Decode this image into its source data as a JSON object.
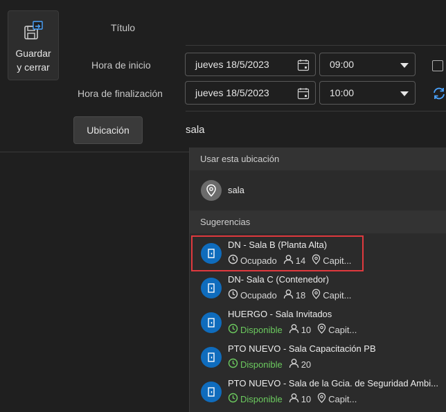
{
  "toolbar": {
    "save_close_label_1": "Guardar",
    "save_close_label_2": "y cerrar"
  },
  "form": {
    "title_label": "Título",
    "start_label": "Hora de inicio",
    "end_label": "Hora de finalización",
    "start_date": "jueves 18/5/2023",
    "start_time": "09:00",
    "end_date": "jueves 18/5/2023",
    "end_time": "10:00",
    "location_button": "Ubicación",
    "location_value": "sala"
  },
  "dropdown": {
    "use_location_header": "Usar esta ubicación",
    "use_location_value": "sala",
    "suggestions_header": "Sugerencias",
    "suggestions": [
      {
        "name": "DN - Sala B (Planta Alta)",
        "status": "Ocupado",
        "capacity": "14",
        "place": "Capit..."
      },
      {
        "name": "DN- Sala C (Contenedor)",
        "status": "Ocupado",
        "capacity": "18",
        "place": "Capit..."
      },
      {
        "name": "HUERGO - Sala Invitados",
        "status": "Disponible",
        "capacity": "10",
        "place": "Capit..."
      },
      {
        "name": "PTO NUEVO - Sala Capacitación PB",
        "status": "Disponible",
        "capacity": "20",
        "place": ""
      },
      {
        "name": "PTO NUEVO - Sala de la Gcia. de Seguridad Ambi...",
        "status": "Disponible",
        "capacity": "10",
        "place": "Capit..."
      }
    ]
  },
  "icons": {
    "save": "save-close-icon",
    "calendar": "calendar-icon",
    "dropdown": "chevron-down-icon",
    "sync": "sync-icon",
    "location": "location-pin-icon",
    "room": "room-door-icon",
    "clock": "clock-icon",
    "person": "person-icon"
  },
  "colors": {
    "accent": "#0f6cbd",
    "available": "#6ccb5f",
    "highlight": "#e0393e"
  }
}
